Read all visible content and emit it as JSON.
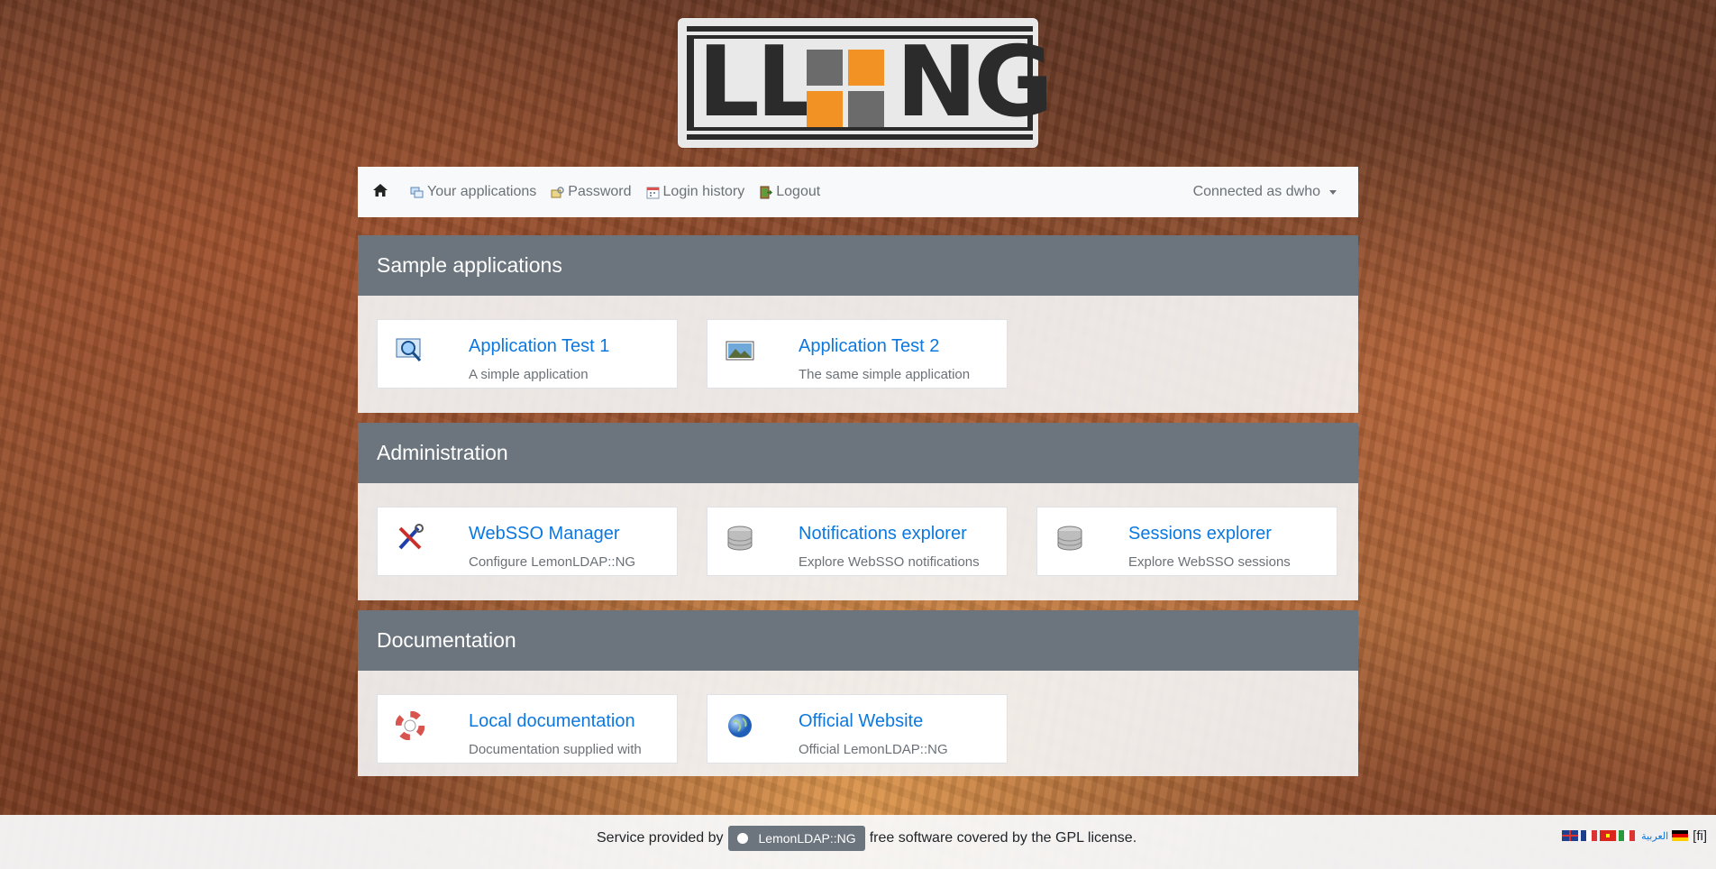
{
  "logo": {
    "text_left": "LL",
    "text_right": "NG",
    "colors": {
      "dark": "#2b2b2b",
      "orange": "#f39224",
      "gray": "#6b6b6b",
      "frame": "#e9e9e9"
    }
  },
  "nav": {
    "home_icon": "home-icon",
    "links": [
      {
        "label": "Your applications",
        "icon": "applications-icon"
      },
      {
        "label": "Password",
        "icon": "password-icon"
      },
      {
        "label": "Login history",
        "icon": "calendar-icon"
      },
      {
        "label": "Logout",
        "icon": "logout-icon"
      }
    ],
    "user": "Connected as dwho"
  },
  "categories": [
    {
      "title": "Sample applications",
      "apps": [
        {
          "title": "Application Test 1",
          "description": "A simple application",
          "icon": "magnifier-icon"
        },
        {
          "title": "Application Test 2",
          "description": "The same simple application",
          "icon": "picture-icon"
        }
      ]
    },
    {
      "title": "Administration",
      "apps": [
        {
          "title": "WebSSO Manager",
          "description": "Configure LemonLDAP::NG",
          "icon": "tools-icon"
        },
        {
          "title": "Notifications explorer",
          "description": "Explore WebSSO notifications",
          "icon": "database-icon"
        },
        {
          "title": "Sessions explorer",
          "description": "Explore WebSSO sessions",
          "icon": "database-icon"
        }
      ]
    },
    {
      "title": "Documentation",
      "apps": [
        {
          "title": "Local documentation",
          "description": "Documentation supplied with",
          "icon": "lifebuoy-icon"
        },
        {
          "title": "Official Website",
          "description": "Official LemonLDAP::NG",
          "icon": "globe-icon"
        }
      ]
    }
  ],
  "footer": {
    "prefix": "Service provided by",
    "badge": "LemonLDAP::NG",
    "suffix": "free software covered by the GPL license."
  },
  "languages": {
    "flags": [
      "en",
      "fr",
      "vi",
      "it"
    ],
    "arabic": "العربية",
    "flag_de": "de",
    "current": "[fi]"
  }
}
